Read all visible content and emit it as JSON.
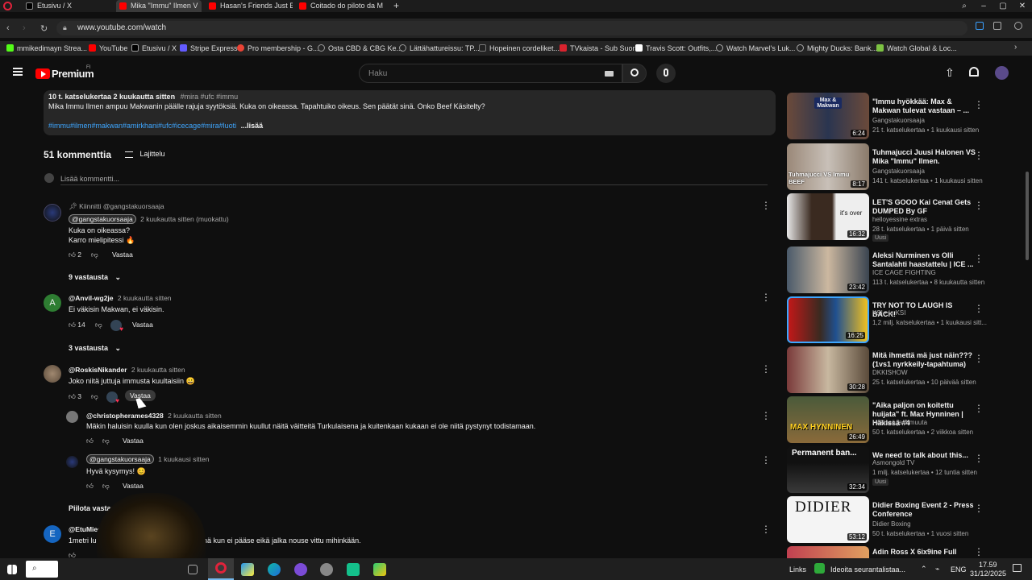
{
  "browser": {
    "tabs": [
      {
        "title": "Etusivu / X",
        "active": false
      },
      {
        "title": "Mika \"Immu\" Ilmen V",
        "active": true
      },
      {
        "title": "Hasan's Friends Just Expo",
        "active": false
      },
      {
        "title": "Coitado do piloto da Mot",
        "active": false
      }
    ],
    "url": "www.youtube.com/watch",
    "bookmarks": [
      "mmikedimayn Strea...",
      "YouTube",
      "Etusivu / X",
      "Stripe Express",
      "Pro membership - G...",
      "Osta CBD & CBG Ke...",
      "Lättähattureissu: TP...",
      "Hopeinen cordeliket...",
      "TVkaista - Sub Suora",
      "Travis Scott: Outfits,...",
      "Watch Marvel's Luk...",
      "Mighty Ducks: Bank...",
      "Watch Global & Loc..."
    ]
  },
  "yt": {
    "logo_text": "Premium",
    "logo_sup": "FI",
    "search_placeholder": "Haku"
  },
  "description": {
    "stats": "10 t. katselukertaa  2 kuukautta sitten",
    "tags_inline": "#mira #ufc #immu",
    "line1": "Mika Immu Ilmen ampuu Makwanin päälle rajuja syytöksiä. Kuka on oikeassa. Tapahtuiko oikeus. Sen päätät sinä. Onko Beef Käsitelty?",
    "hashtags": "#immu#ilmen#makwan#amirkhani#ufc#icecage#mira#luoti",
    "more": "...lisää"
  },
  "comments": {
    "count_label": "51 kommenttia",
    "sort_label": "Lajittelu",
    "add_placeholder": "Lisää kommentti...",
    "items": [
      {
        "pinned": "Kiinnitti @gangstakuorsaaja",
        "author": "@gangstakuorsaaja",
        "time": "2 kuukautta sitten (muokattu)",
        "line1": "Kuka on oikeassa?",
        "line2": "Karro mielipitessi 🔥",
        "likes": "2",
        "reply": "Vastaa",
        "replies_toggle": "9 vastausta"
      },
      {
        "author": "@Anvil-wg2je",
        "time": "2 kuukautta sitten",
        "line1": "Ei väkisin Makwan, ei väkisin.",
        "likes": "14",
        "reply": "Vastaa",
        "replies_toggle": "3 vastausta"
      },
      {
        "author": "@RoskisNikander",
        "time": "2 kuukautta sitten",
        "line1": "Joko niitä juttuja immusta kuultaisiin 😀",
        "likes": "3",
        "reply": "Vastaa"
      }
    ],
    "replies": [
      {
        "author": "@christopherames4328",
        "time": "2 kuukautta sitten",
        "line1": "Mäkin haluisin kuulla kun olen joskus aikaisemmin kuullut näitä väitteitä Turkulaisena ja kuitenkaan kukaan ei ole niitä pystynyt todistamaan.",
        "reply": "Vastaa"
      },
      {
        "author": "@gangstakuorsaaja",
        "time": "1 kuukausi sitten",
        "line1": "Hyvä kysymys! 😊",
        "reply": "Vastaa"
      }
    ],
    "hide_replies": "Piilota vastaukset",
    "last": {
      "author": "@EtuMies-v",
      "line1_left": "1metri lu",
      "line1_right": "misenä kun ei pääse eikä jalka nouse vittu mihinkään."
    }
  },
  "sidebar": {
    "videos": [
      {
        "title": "\"Immu hyökkää: Max & Makwan tulevat vastaan – ...",
        "channel": "Gangstakuorsaaja",
        "meta": "21 t. katselukertaa • 1 kuukausi sitten",
        "duration": "6:24",
        "thumb_text": "Max & Makwan"
      },
      {
        "title": "Tuhmajucci Juusi Halonen VS Mika \"Immu\" Ilmen.",
        "channel": "Gangstakuorsaaja",
        "meta": "141 t. katselukertaa • 1 kuukausi sitten",
        "duration": "8:17",
        "thumb_text": "Tuhmajucci VS Immu BEEF"
      },
      {
        "title": "LET'S GOOO Kai Cenat Gets DUMPED By GF",
        "channel": "helloyessine extras",
        "meta": "28 t. katselukertaa • 1 päivä sitten",
        "duration": "16:32",
        "badge": "Uusi",
        "thumb_text": "it's over"
      },
      {
        "title": "Aleksi Nurminen vs Olli Santalahti haastattelu | ICE ...",
        "channel": "ICE CAGE FIGHTING",
        "meta": "113 t. katselukertaa • 8 kuukautta sitten",
        "duration": "23:42"
      },
      {
        "title": "TRY NOT TO LAUGH IS BACK!",
        "channel": "KSI • ja KSI",
        "meta": "1,2 milj. katselukertaa • 1 kuukausi sitt...",
        "duration": "16:25"
      },
      {
        "title": "Mitä ihmettä mä just näin??? (1vs1 nyrkkeily-tapahtuma)",
        "channel": "DKKISHOW",
        "meta": "25 t. katselukertaa • 10 päivää sitten",
        "duration": "30:28"
      },
      {
        "title": "\"Aika paljon on koitettu huijata\" ft. Max Hynninen | Häkissä #4",
        "channel": "Häkissä ja 3 muuta",
        "meta": "50 t. katselukertaa • 2 viikkoa sitten",
        "duration": "26:49",
        "thumb_text": "MAX HYNNINEN"
      },
      {
        "title": "We need to talk about this...",
        "channel": "Asmongold TV",
        "meta": "1 milj. katselukertaa • 12 tuntia sitten",
        "duration": "32:34",
        "badge": "Uusi",
        "thumb_text": "Permanent ban..."
      },
      {
        "title": "Didier Boxing Event 2 - Press Conference",
        "channel": "Didier Boxing",
        "meta": "50 t. katselukertaa • 1 vuosi sitten",
        "duration": "53:12",
        "thumb_text": "DIDIER"
      },
      {
        "title": "Adin Ross X 6ix9ine Full",
        "channel": "",
        "meta": "",
        "duration": ""
      }
    ]
  },
  "taskbar": {
    "links": "Links",
    "news": "Ideoita seurantalistaa...",
    "lang": "ENG",
    "time": "17.59",
    "date": "31/12/2025"
  },
  "colors": {
    "bg": "#0f0f0f",
    "chrome": "#242424",
    "accent_red": "#ff0000",
    "link_blue": "#3ea6ff"
  }
}
